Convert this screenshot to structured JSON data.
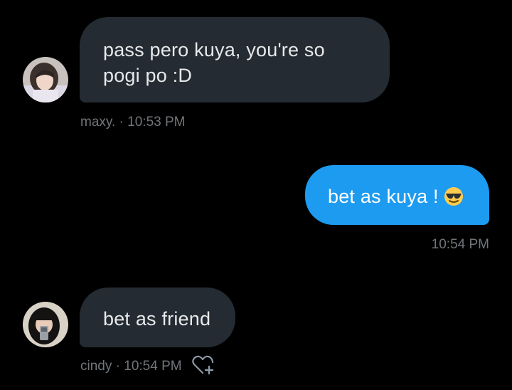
{
  "messages": [
    {
      "direction": "incoming",
      "text": "pass pero kuya, you're so pogi po :D",
      "sender": "maxy.",
      "separator": "·",
      "time": "10:53 PM"
    },
    {
      "direction": "outgoing",
      "text": "bet as kuya !",
      "emoji": "smiling-face-with-sunglasses",
      "time": "10:54 PM"
    },
    {
      "direction": "incoming",
      "text": "bet as friend",
      "sender": "cindy",
      "separator": "·",
      "time": "10:54 PM",
      "action_icon": "add-reaction-heart-icon"
    }
  ],
  "colors": {
    "background": "#000000",
    "incoming_bubble": "#242b33",
    "outgoing_bubble": "#1d9bf0",
    "meta_text": "#71767b"
  }
}
